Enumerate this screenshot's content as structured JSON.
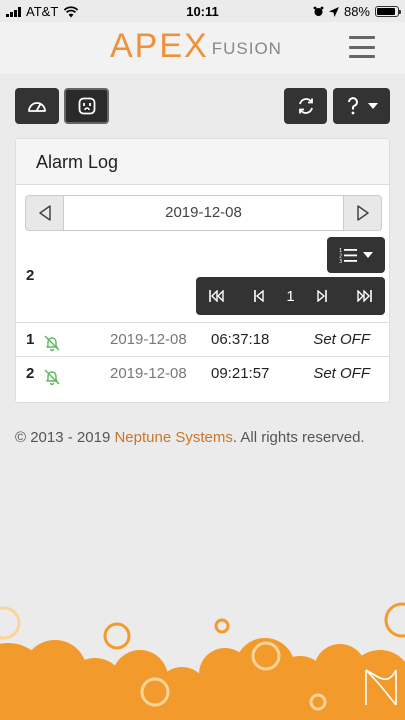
{
  "status_bar": {
    "carrier": "AT&T",
    "time": "10:11",
    "battery": "88%",
    "battery_level": 0.88
  },
  "header": {
    "logo_primary": "APEX",
    "logo_secondary": "FUSION",
    "menu_icon": "hamburger-icon"
  },
  "toolbar": {
    "left_buttons": [
      {
        "icon": "dashboard-icon"
      },
      {
        "icon": "outlet-icon"
      }
    ],
    "right_buttons": [
      {
        "icon": "refresh-icon"
      },
      {
        "icon": "help-icon"
      }
    ]
  },
  "alarm_log": {
    "title": "Alarm Log",
    "date": "2019-12-08",
    "count": "2",
    "page": "1",
    "rows": [
      {
        "index": "1",
        "date": "2019-12-08",
        "time": "06:37:18",
        "action": "Set OFF",
        "icon": "bell-off-icon"
      },
      {
        "index": "2",
        "date": "2019-12-08",
        "time": "09:21:57",
        "action": "Set OFF",
        "icon": "bell-off-icon"
      }
    ]
  },
  "footer": {
    "prefix": "© 2013 - 2019 ",
    "brand": "Neptune Systems",
    "suffix": ". All rights reserved."
  },
  "colors": {
    "accent": "#f0913a",
    "brand_link": "#c8762e",
    "bell": "#5cb85c",
    "button_dark": "#333333"
  }
}
